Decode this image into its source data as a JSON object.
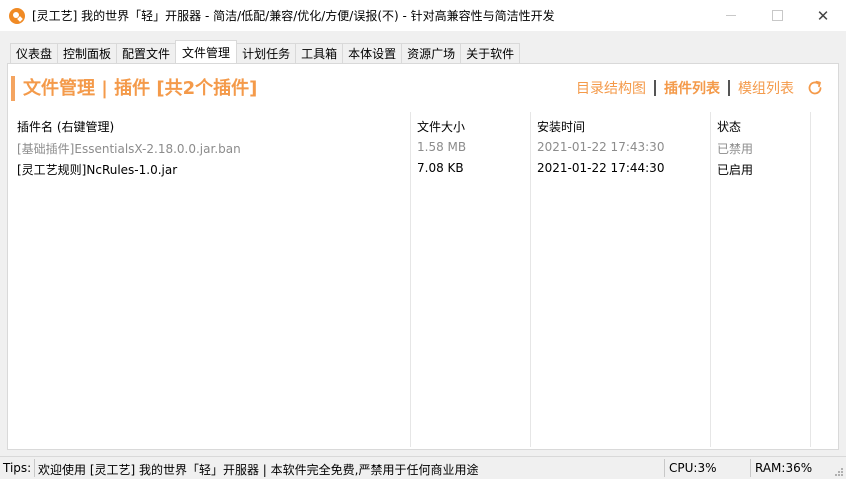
{
  "window": {
    "title": "[灵工艺] 我的世界「轻」开服器 - 简洁/低配/兼容/优化/方便/误报(不)  - 针对高兼容性与简洁性开发",
    "close_glyph": "✕"
  },
  "tabs": [
    {
      "label": "仪表盘"
    },
    {
      "label": "控制面板"
    },
    {
      "label": "配置文件"
    },
    {
      "label": "文件管理",
      "active": true
    },
    {
      "label": "计划任务"
    },
    {
      "label": "工具箱"
    },
    {
      "label": "本体设置"
    },
    {
      "label": "资源广场"
    },
    {
      "label": "关于软件"
    }
  ],
  "panel": {
    "title": "文件管理 | 插件 [共2个插件]",
    "views": {
      "tree": "目录结构图",
      "plugins": "插件列表",
      "mods": "模组列表"
    }
  },
  "table": {
    "headers": {
      "name": "插件名 (右键管理)",
      "size": "文件大小",
      "installed": "安装时间",
      "status": "状态"
    },
    "rows": [
      {
        "name": "[基础插件]EssentialsX-2.18.0.0.jar.ban",
        "size": "1.58 MB",
        "installed": "2021-01-22 17:43:30",
        "status": "已禁用",
        "disabled": true
      },
      {
        "name": "[灵工艺规则]NcRules-1.0.jar",
        "size": "7.08 KB",
        "installed": "2021-01-22 17:44:30",
        "status": "已启用",
        "disabled": false
      }
    ]
  },
  "statusbar": {
    "tips_label": "Tips:",
    "tips_text": "欢迎使用 [灵工艺] 我的世界「轻」开服器 | 本软件完全免费,严禁用于任何商业用途",
    "cpu": "CPU:3%",
    "ram": "RAM:36%"
  },
  "colors": {
    "accent": "#f49a4a",
    "accent_bar": "#f4a460",
    "disabled_text": "#8c8c8c"
  }
}
